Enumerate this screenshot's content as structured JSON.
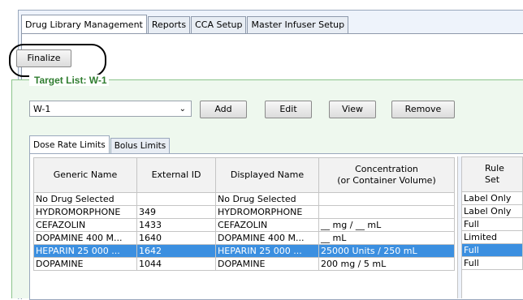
{
  "tabs": [
    {
      "label": "Drug Library Management"
    },
    {
      "label": "Reports"
    },
    {
      "label": "CCA Setup"
    },
    {
      "label": "Master Infuser Setup"
    }
  ],
  "toolbar": {
    "finalize_label": "Finalize"
  },
  "target_list": {
    "title": "Target List: W-1",
    "selected": "W-1",
    "buttons": {
      "add": "Add",
      "edit": "Edit",
      "view": "View",
      "remove": "Remove"
    }
  },
  "subtabs": [
    {
      "label": "Dose Rate Limits"
    },
    {
      "label": "Bolus Limits"
    }
  ],
  "table": {
    "headers": {
      "generic": "Generic Name",
      "external": "External ID",
      "displayed": "Displayed Name",
      "conc_line1": "Concentration",
      "conc_line2": "(or Container Volume)",
      "rule": "Rule Set"
    },
    "rows": [
      {
        "generic": "No Drug Selected",
        "external": "",
        "displayed": "No Drug Selected",
        "conc": "",
        "rule": "Label Only"
      },
      {
        "generic": "HYDROMORPHONE",
        "external": "349",
        "displayed": "HYDROMORPHONE",
        "conc": "",
        "rule": "Label Only"
      },
      {
        "generic": "CEFAZOLIN",
        "external": "1433",
        "displayed": "CEFAZOLIN",
        "conc": "__ mg / __ mL",
        "rule": "Full"
      },
      {
        "generic": "DOPAMINE 400 M...",
        "external": "1640",
        "displayed": "DOPAMINE 400 M...",
        "conc": "__ mL",
        "rule": "Limited"
      },
      {
        "generic": "HEPARIN 25 000 ...",
        "external": "1642",
        "displayed": "HEPARIN 25 000 ...",
        "conc": "25000 Units / 250 mL",
        "rule": "Full"
      },
      {
        "generic": "DOPAMINE",
        "external": "1044",
        "displayed": "DOPAMINE",
        "conc": "200 mg / 5 mL",
        "rule": "Full"
      }
    ]
  }
}
